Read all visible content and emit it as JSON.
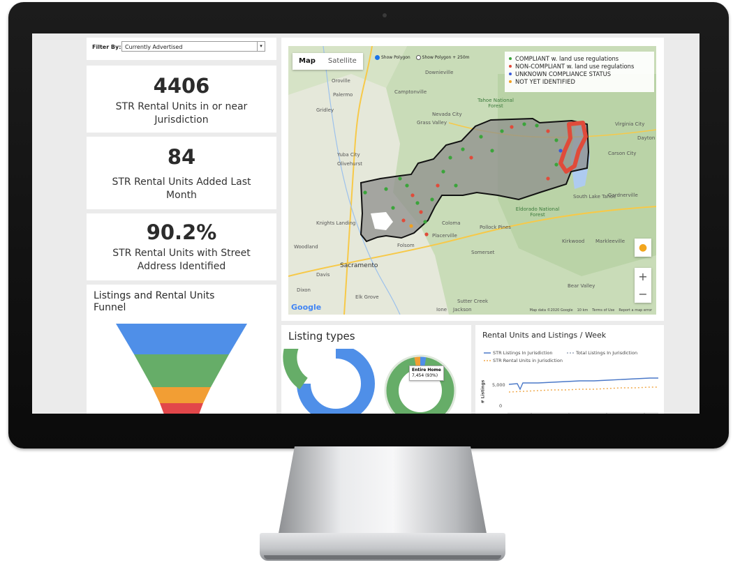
{
  "filter": {
    "label": "Filter By:",
    "value": "Currently Advertised"
  },
  "kpis": [
    {
      "value": "4406",
      "label_line1": "STR Rental Units in or near",
      "label_line2": "Jurisdiction"
    },
    {
      "value": "84",
      "label_line1": "STR Rental Units Added Last",
      "label_line2": "Month"
    },
    {
      "value": "90.2%",
      "label_line1": "STR Rental Units with Street",
      "label_line2": "Address Identified"
    }
  ],
  "funnel": {
    "title_line1": "Listings and Rental Units",
    "title_line2": "Funnel",
    "colors": [
      "#4f8fe8",
      "#66ad68",
      "#f29e34",
      "#e2474a"
    ]
  },
  "map": {
    "tabs": [
      "Map",
      "Satellite"
    ],
    "active_tab": "Map",
    "polygon_options": [
      "Show Polygon",
      "Show Polygon + 250m"
    ],
    "legend": [
      {
        "label": "COMPLIANT w. land use regulations",
        "color": "#3ba43b"
      },
      {
        "label": "NON-COMPLIANT w. land use regulations",
        "color": "#e04b3a"
      },
      {
        "label": "UNKNOWN COMPLIANCE STATUS",
        "color": "#3a5bd9"
      },
      {
        "label": "NOT YET IDENTIFIED",
        "color": "#f0a020"
      }
    ],
    "cities": [
      "Oroville",
      "Palermo",
      "Gridley",
      "Yuba City",
      "Olivehurst",
      "Knights Landing",
      "Woodland",
      "Davis",
      "Sacramento",
      "Elk Grove",
      "Folsom",
      "Placerville",
      "Coloma",
      "Pollock Pines",
      "Somerset",
      "Kirkwood",
      "Markleeville",
      "Bear Valley",
      "Ione",
      "Jackson",
      "Sutter Creek",
      "Carson City",
      "Gardnerville",
      "South Lake Tahoe",
      "Virginia City",
      "Dayton",
      "Nevada City",
      "Grass Valley",
      "Downieville",
      "Camptonville",
      "Dixon"
    ],
    "forests": [
      "Tahoe National Forest",
      "Eldorado National Forest"
    ],
    "google_label": "Google",
    "attribution": [
      "Map data ©2020 Google",
      "10 km",
      "Terms of Use",
      "Report a map error"
    ],
    "zoom_in": "+",
    "zoom_out": "−"
  },
  "listing_types": {
    "title": "Listing types",
    "tooltip_title": "Entire Home",
    "tooltip_value": "7,454 (93%)",
    "donut1": [
      0.62,
      0.24,
      0.14
    ],
    "donut2": [
      0.93,
      0.03,
      0.02,
      0.02
    ]
  },
  "rental_chart": {
    "title": "Rental Units and Listings / Week",
    "legend": [
      "STR Listings In Jurisdiction",
      "Total Listings In Jurisdiction",
      "STR Rental Units in Jurisdiction"
    ],
    "ylabel": "# Listings",
    "yticks": [
      "5,000",
      "0"
    ],
    "colors": [
      "#4a78c8",
      "#9aa6b8",
      "#f0a94a"
    ]
  }
}
